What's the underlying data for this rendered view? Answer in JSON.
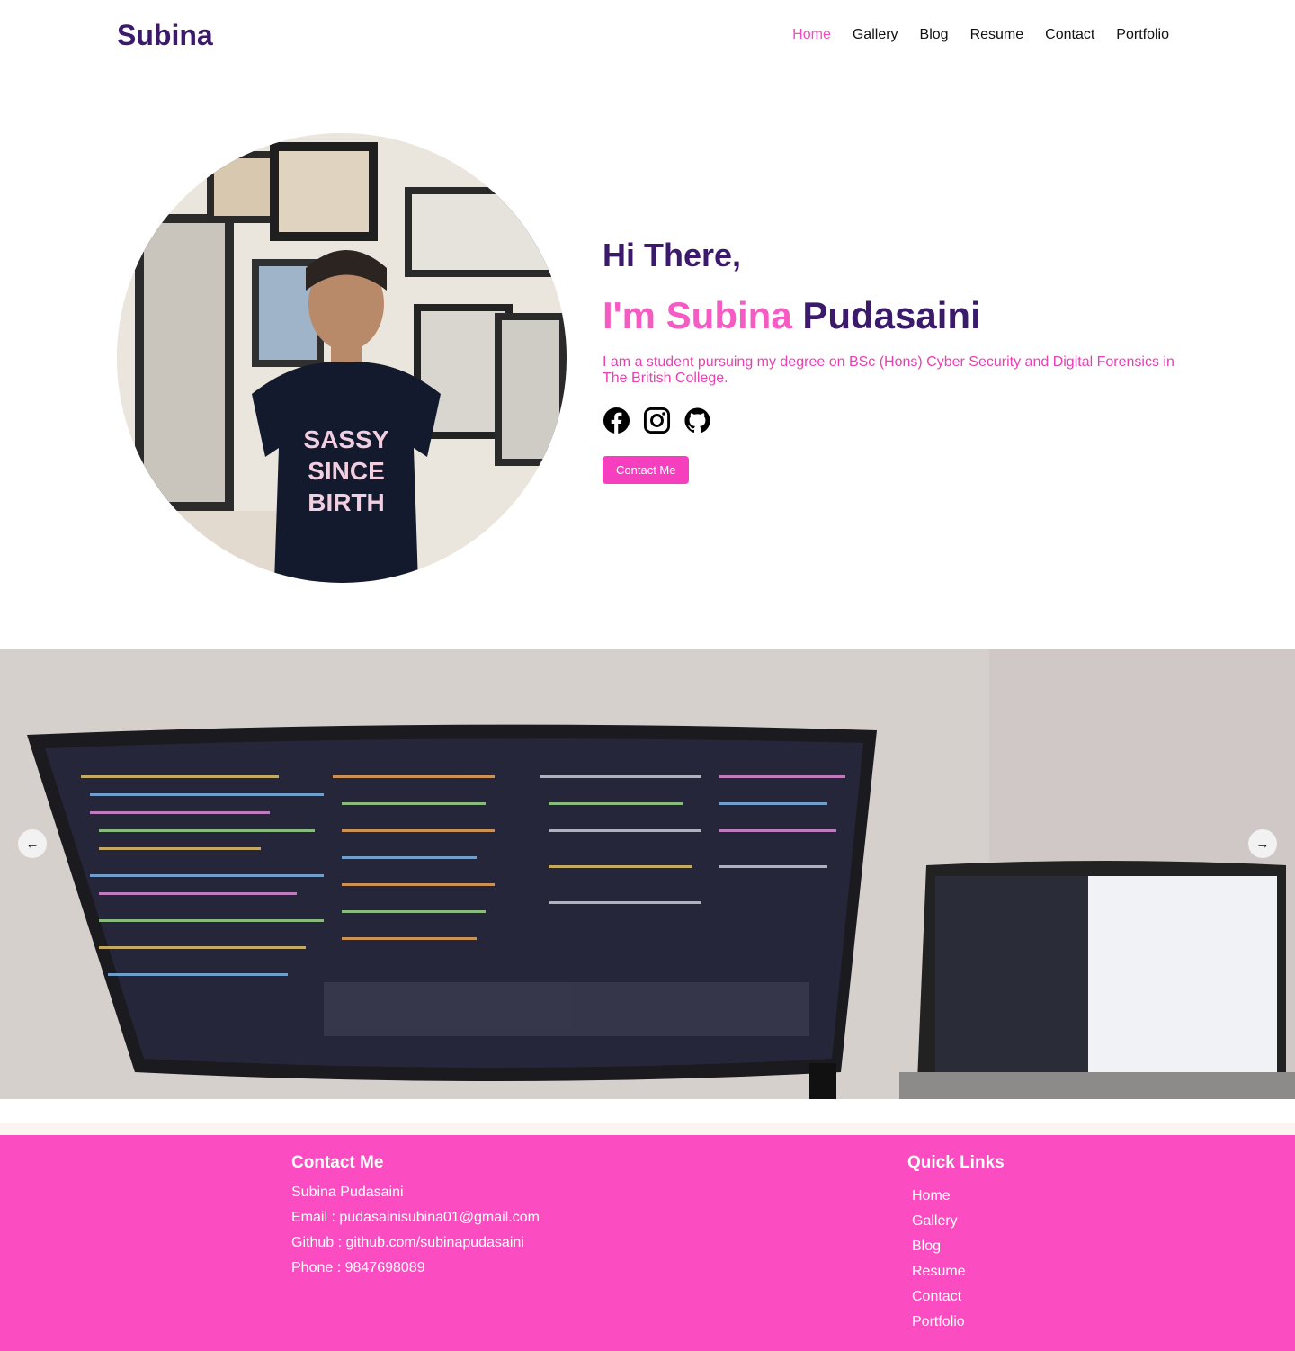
{
  "header": {
    "logo": "Subina",
    "nav": [
      {
        "label": "Home",
        "active": true
      },
      {
        "label": "Gallery",
        "active": false
      },
      {
        "label": "Blog",
        "active": false
      },
      {
        "label": "Resume",
        "active": false
      },
      {
        "label": "Contact",
        "active": false
      },
      {
        "label": "Portfolio",
        "active": false
      }
    ]
  },
  "hero": {
    "greeting": "Hi There,",
    "name_first": "I'm Subina",
    "name_last": "Pudasaini",
    "bio": "I am a student pursuing my degree on BSc (Hons) Cyber Security and Digital Forensics in The British College.",
    "socials": [
      "facebook-icon",
      "instagram-icon",
      "github-icon"
    ],
    "cta_label": "Contact Me",
    "shirt_text": [
      "SASSY",
      "SINCE",
      "BIRTH"
    ]
  },
  "carousel": {
    "prev_icon": "arrow-left-icon",
    "next_icon": "arrow-right-icon"
  },
  "footer": {
    "contact": {
      "title": "Contact Me",
      "name": "Subina Pudasaini",
      "email": "Email : pudasainisubina01@gmail.com",
      "github": "Github : github.com/subinapudasaini",
      "phone": "Phone : 9847698089"
    },
    "quick_links": {
      "title": "Quick Links",
      "items": [
        "Home",
        "Gallery",
        "Blog",
        "Resume",
        "Contact",
        "Portfolio"
      ]
    }
  },
  "colors": {
    "brand_purple": "#3b1a6b",
    "accent_pink": "#f24dbf",
    "footer_pink": "#fb4cc1"
  }
}
